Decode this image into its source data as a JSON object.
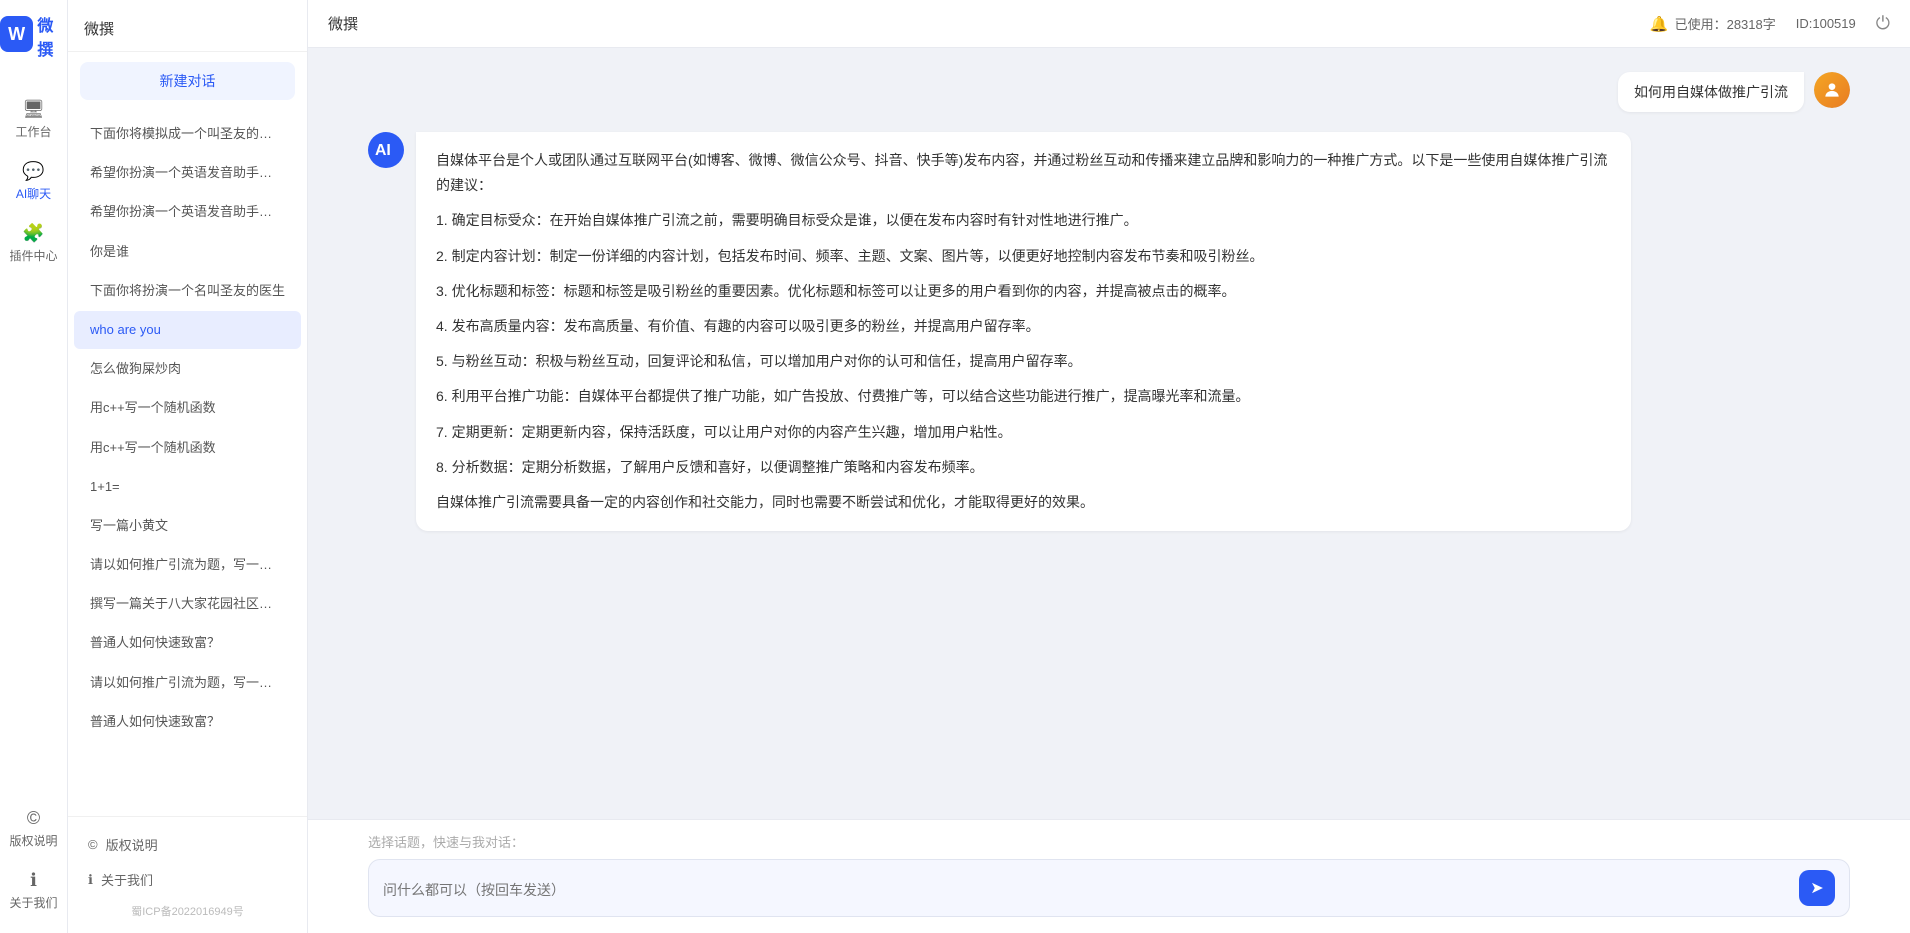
{
  "app": {
    "name": "微撰",
    "logo_letter": "W"
  },
  "topbar": {
    "title": "微撰",
    "usage_label": "已使用：28318字",
    "id_label": "ID:100519",
    "token_icon": "🔔"
  },
  "nav": {
    "items": [
      {
        "id": "workbench",
        "label": "工作台",
        "icon": "🖥"
      },
      {
        "id": "aichat",
        "label": "AI聊天",
        "icon": "💬"
      },
      {
        "id": "plugin",
        "label": "插件中心",
        "icon": "🧩"
      }
    ],
    "bottom": [
      {
        "id": "copyright",
        "label": "版权说明",
        "icon": "©"
      },
      {
        "id": "about",
        "label": "关于我们",
        "icon": "ℹ"
      }
    ],
    "beian": "蜀ICP备2022016949号"
  },
  "sidebar": {
    "header": "微撰",
    "new_btn_label": "新建对话",
    "items": [
      {
        "label": "下面你将模拟成一个叫圣友的程序员、我说...",
        "active": false
      },
      {
        "label": "希望你扮演一个英语发音助手，我提供给你...",
        "active": false
      },
      {
        "label": "希望你扮演一个英语发音助手，我提供给你...",
        "active": false
      },
      {
        "label": "你是谁",
        "active": false
      },
      {
        "label": "下面你将扮演一个名叫圣友的医生",
        "active": false
      },
      {
        "label": "who are you",
        "active": true
      },
      {
        "label": "怎么做狗屎炒肉",
        "active": false
      },
      {
        "label": "用c++写一个随机函数",
        "active": false
      },
      {
        "label": "用c++写一个随机函数",
        "active": false
      },
      {
        "label": "1+1=",
        "active": false
      },
      {
        "label": "写一篇小黄文",
        "active": false
      },
      {
        "label": "请以如何推广引流为题，写一篇大纲",
        "active": false
      },
      {
        "label": "撰写一篇关于八大家花园社区一刻钟便民生...",
        "active": false
      },
      {
        "label": "普通人如何快速致富？",
        "active": false
      },
      {
        "label": "请以如何推广引流为题，写一篇大纲",
        "active": false
      },
      {
        "label": "普通人如何快速致富？",
        "active": false
      }
    ],
    "footer": [
      {
        "id": "copyright",
        "label": "版权说明",
        "icon": "©"
      },
      {
        "id": "about",
        "label": "关于我们",
        "icon": "ℹ"
      }
    ],
    "beian": "蜀ICP备2022016949号"
  },
  "chat": {
    "user_avatar_initial": "👤",
    "ai_avatar_label": "AI",
    "messages": [
      {
        "type": "user",
        "text": "如何用自媒体做推广引流"
      },
      {
        "type": "ai",
        "paragraphs": [
          "自媒体平台是个人或团队通过互联网平台(如博客、微博、微信公众号、抖音、快手等)发布内容，并通过粉丝互动和传播来建立品牌和影响力的一种推广方式。以下是一些使用自媒体推广引流的建议：",
          "1. 确定目标受众：在开始自媒体推广引流之前，需要明确目标受众是谁，以便在发布内容时有针对性地进行推广。",
          "2. 制定内容计划：制定一份详细的内容计划，包括发布时间、频率、主题、文案、图片等，以便更好地控制内容发布节奏和吸引粉丝。",
          "3. 优化标题和标签：标题和标签是吸引粉丝的重要因素。优化标题和标签可以让更多的用户看到你的内容，并提高被点击的概率。",
          "4. 发布高质量内容：发布高质量、有价值、有趣的内容可以吸引更多的粉丝，并提高用户留存率。",
          "5. 与粉丝互动：积极与粉丝互动，回复评论和私信，可以增加用户对你的认可和信任，提高用户留存率。",
          "6. 利用平台推广功能：自媒体平台都提供了推广功能，如广告投放、付费推广等，可以结合这些功能进行推广，提高曝光率和流量。",
          "7. 定期更新：定期更新内容，保持活跃度，可以让用户对你的内容产生兴趣，增加用户粘性。",
          "8. 分析数据：定期分析数据，了解用户反馈和喜好，以便调整推广策略和内容发布频率。",
          "自媒体推广引流需要具备一定的内容创作和社交能力，同时也需要不断尝试和优化，才能取得更好的效果。"
        ]
      }
    ]
  },
  "input": {
    "quick_label": "选择话题，快速与我对话：",
    "placeholder": "问什么都可以（按回车发送）"
  }
}
